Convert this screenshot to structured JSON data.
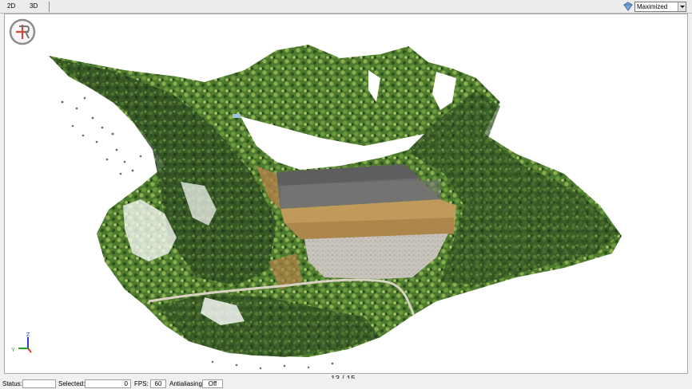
{
  "toolbar": {
    "tabs": [
      "2D",
      "3D"
    ],
    "view_mode_icon": "view-mode-icon",
    "view_mode": {
      "selected": "Maximized"
    }
  },
  "viewport": {
    "logo_icon": "logo-icon",
    "axis": {
      "z": "Z",
      "y": "Y",
      "x": "X"
    }
  },
  "page_indicator": "13 / 15",
  "status": {
    "status_label": "Status:",
    "status_value": "",
    "selected_label": "Selected:",
    "selected_value": "0",
    "fps_label": "FPS:",
    "fps_value": "60",
    "antialiasing_label": "Antialiasing:",
    "antialiasing_value": "Off"
  },
  "colors": {
    "vegetation": "#4d7a2e",
    "vegetation_light": "#8cae4e",
    "vegetation_dark": "#243f1a",
    "roof": "#6b6b6b",
    "soil": "#c09a5a",
    "gravel": "#c8c4bc"
  }
}
